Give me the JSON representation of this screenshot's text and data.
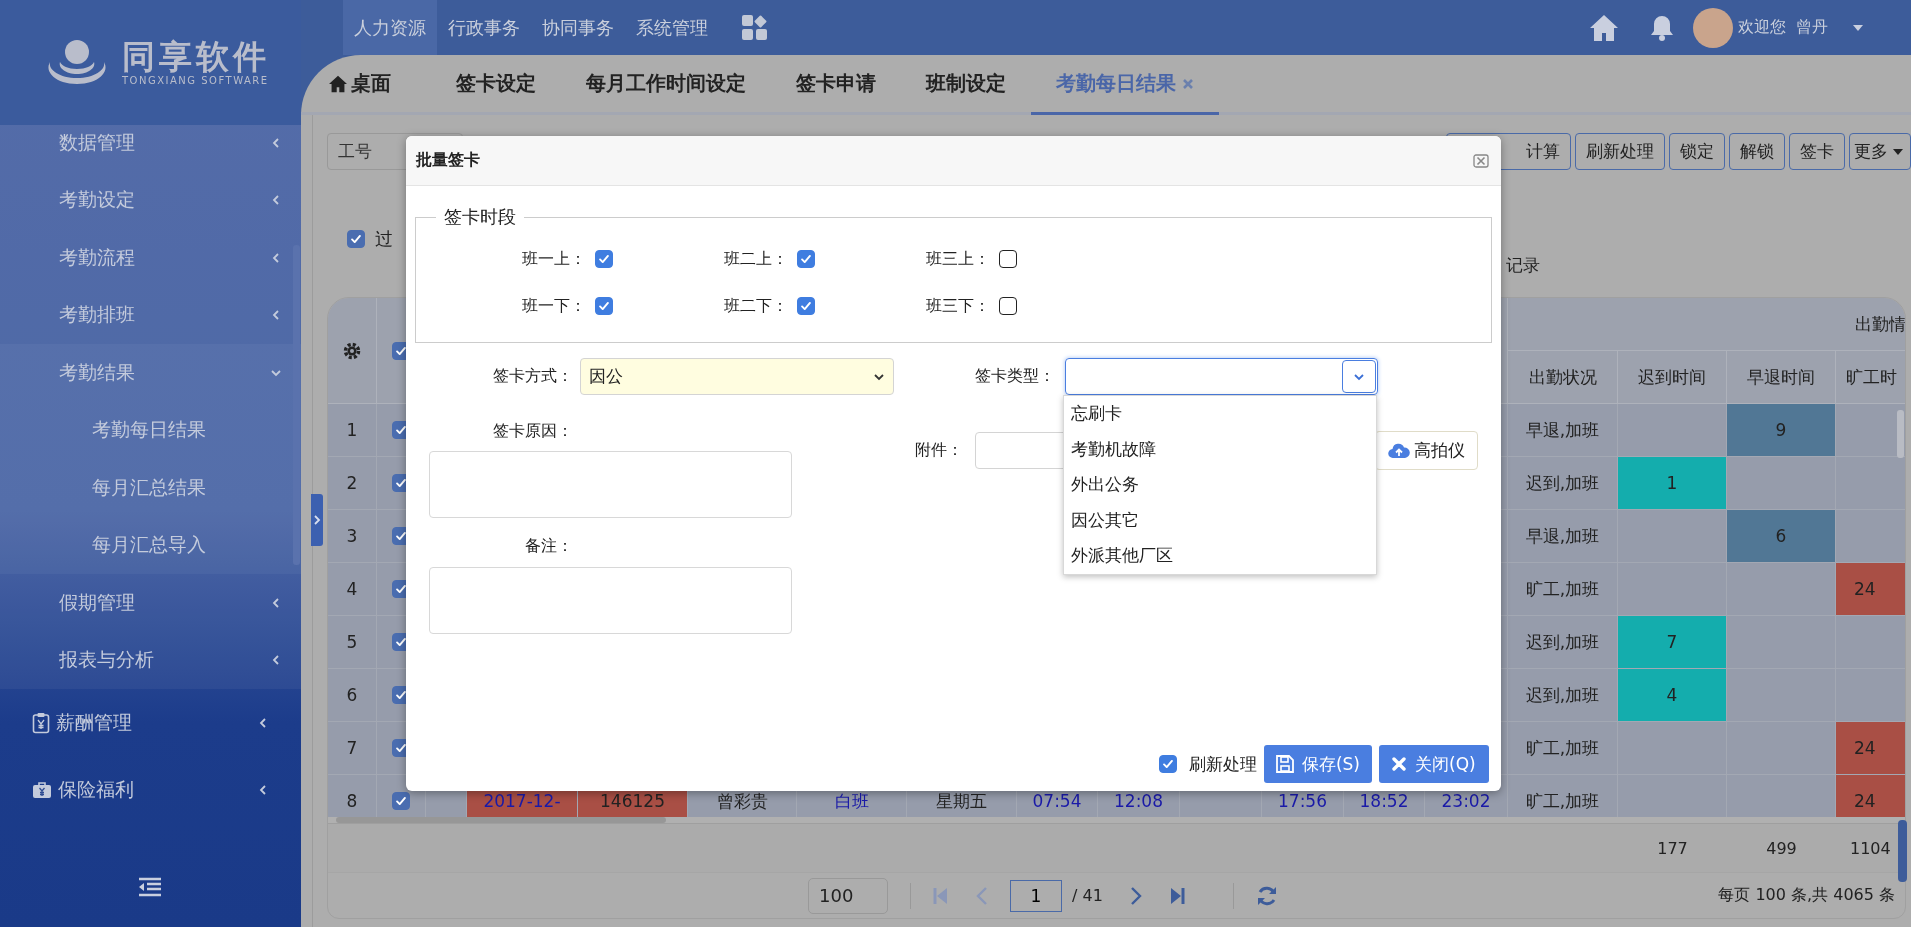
{
  "logo": {
    "name": "同享软件",
    "tagline": "TONGXIANG SOFTWARE"
  },
  "top_nav": {
    "menus": [
      {
        "label": "人力资源",
        "selected": true
      },
      {
        "label": "行政事务",
        "selected": false
      },
      {
        "label": "协同事务",
        "selected": false
      },
      {
        "label": "系统管理",
        "selected": false
      }
    ],
    "greeting": "欢迎您",
    "user_name": "曾丹"
  },
  "sidebar": {
    "items": [
      {
        "label": "数据管理",
        "kind": "sub",
        "expanded": false
      },
      {
        "label": "考勤设定",
        "kind": "sub",
        "expanded": false
      },
      {
        "label": "考勤流程",
        "kind": "sub",
        "expanded": false
      },
      {
        "label": "考勤排班",
        "kind": "sub",
        "expanded": false
      },
      {
        "label": "考勤结果",
        "kind": "sub",
        "expanded": true,
        "children": [
          {
            "label": "考勤每日结果"
          },
          {
            "label": "每月汇总结果"
          },
          {
            "label": "每月汇总导入"
          }
        ]
      },
      {
        "label": "假期管理",
        "kind": "sub",
        "expanded": false
      },
      {
        "label": "报表与分析",
        "kind": "sub",
        "expanded": false
      },
      {
        "label": "薪酬管理",
        "kind": "salary",
        "expanded": false
      },
      {
        "label": "保险福利",
        "kind": "insurance",
        "expanded": false
      }
    ]
  },
  "tabs": [
    {
      "label": "桌面",
      "kind": "home",
      "selected": false,
      "closable": false
    },
    {
      "label": "签卡设定",
      "kind": "page",
      "selected": false,
      "closable": false
    },
    {
      "label": "每月工作时间设定",
      "kind": "page",
      "selected": false,
      "closable": false
    },
    {
      "label": "签卡申请",
      "kind": "page",
      "selected": false,
      "closable": false
    },
    {
      "label": "班制设定",
      "kind": "page",
      "selected": false,
      "closable": false
    },
    {
      "label": "考勤每日结果",
      "kind": "page",
      "selected": true,
      "closable": true
    }
  ],
  "toolbar": {
    "search_field": {
      "placeholder": "工号"
    },
    "buttons": [
      {
        "label": "计算",
        "kind": "plain"
      },
      {
        "label": "刷新处理",
        "kind": "plain"
      },
      {
        "label": "锁定",
        "kind": "plain"
      },
      {
        "label": "解锁",
        "kind": "plain"
      },
      {
        "label": "签卡",
        "kind": "plain"
      },
      {
        "label": "更多",
        "kind": "menu"
      }
    ]
  },
  "filter": {
    "checkbox": {
      "label": "过",
      "checked": true
    },
    "note": "记录"
  },
  "table": {
    "header_checked": true,
    "group_header": "出勤情",
    "columns": [
      {
        "label": "出勤状况"
      },
      {
        "label": "迟到时间"
      },
      {
        "label": "早退时间"
      },
      {
        "label": "旷工时"
      }
    ],
    "rows": [
      {
        "number": "1",
        "checked": true,
        "status": "早退,加班",
        "early": "9"
      },
      {
        "number": "2",
        "checked": true,
        "status": "迟到,加班",
        "late": "1"
      },
      {
        "number": "3",
        "checked": true,
        "status": "早退,加班",
        "early": "6"
      },
      {
        "number": "4",
        "checked": true,
        "status": "旷工,加班",
        "absent": "24"
      },
      {
        "number": "5",
        "checked": true,
        "status": "迟到,加班",
        "late": "7"
      },
      {
        "number": "6",
        "checked": true,
        "status": "迟到,加班",
        "late": "4"
      },
      {
        "number": "7",
        "checked": true,
        "status": "旷工,加班",
        "absent": "24"
      },
      {
        "number": "8",
        "checked": true,
        "status": "旷工,加班",
        "absent": "24",
        "cells": [
          null,
          {
            "text": "2017-12-",
            "kind": "link",
            "flagged": true
          },
          {
            "text": "146125",
            "kind": "plain",
            "flagged": true
          },
          {
            "text": "曾彩贵",
            "kind": "plain",
            "flagged": false
          },
          {
            "text": "白班",
            "kind": "link",
            "flagged": false
          },
          {
            "text": "星期五",
            "kind": "plain",
            "flagged": false
          },
          {
            "text": "07:54",
            "kind": "link",
            "flagged": false
          },
          {
            "text": "12:08",
            "kind": "link",
            "flagged": false
          },
          null,
          {
            "text": "17:56",
            "kind": "link",
            "flagged": false
          },
          {
            "text": "18:52",
            "kind": "link",
            "flagged": false
          },
          {
            "text": "23:02",
            "kind": "link",
            "flagged": false
          }
        ]
      }
    ],
    "totals": [
      "177",
      "499",
      "1104"
    ]
  },
  "pager": {
    "page_size": "100",
    "page": "1",
    "total_pages": "/ 41",
    "summary": "每页 100 条,共 4065 条"
  },
  "dialog": {
    "title": "批量签卡",
    "period_legend": "签卡时段",
    "periods": [
      {
        "label": "班一上：",
        "checked": true
      },
      {
        "label": "班二上：",
        "checked": true
      },
      {
        "label": "班三上：",
        "checked": false
      },
      {
        "label": "班一下：",
        "checked": true
      },
      {
        "label": "班二下：",
        "checked": true
      },
      {
        "label": "班三下：",
        "checked": false
      }
    ],
    "method": {
      "label": "签卡方式：",
      "value": "因公"
    },
    "type": {
      "label": "签卡类型：",
      "expanded": true,
      "options": [
        "忘刷卡",
        "考勤机故障",
        "外出公务",
        "因公其它",
        "外派其他厂区"
      ]
    },
    "reason": {
      "label": "签卡原因："
    },
    "attachment": {
      "label": "附件：",
      "button": "高拍仪"
    },
    "remark": {
      "label": "备注："
    },
    "refresh": {
      "label": "刷新处理",
      "checked": true
    },
    "buttons": [
      {
        "label": "保存(S)",
        "kind": "save"
      },
      {
        "label": "关闭(Q)",
        "kind": "close"
      }
    ]
  }
}
